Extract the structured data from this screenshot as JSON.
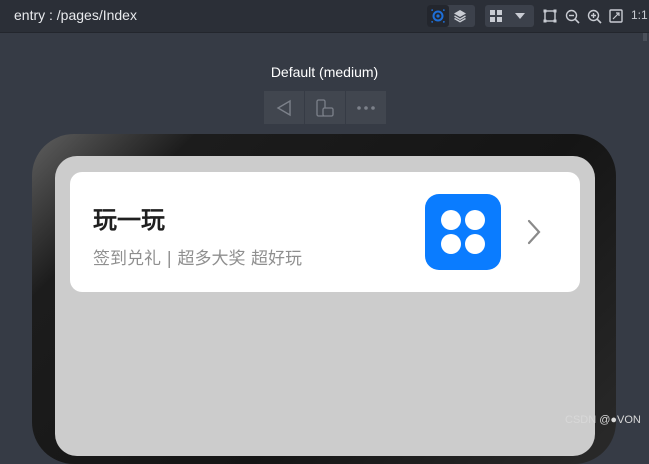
{
  "toolbar": {
    "route": "entry : /pages/Index",
    "zoom_one_to_one": "1:1",
    "icons": [
      "inspect-icon",
      "layers-icon",
      "layout-grid-icon",
      "dropdown-icon",
      "crop-icon",
      "zoom-out-icon",
      "zoom-in-icon",
      "fit-icon"
    ]
  },
  "preview": {
    "device_label": "Default (medium)",
    "controls": [
      "back-icon",
      "rotate-device-icon",
      "more-icon"
    ]
  },
  "card": {
    "title": "玩一玩",
    "subtitle": "签到兑礼 | 超多大奖 超好玩",
    "icon_color": "#0a7cff"
  },
  "watermark": "CSDN @●VON",
  "colors": {
    "background": "#363b45",
    "toolbar": "#2b2f37",
    "screen": "#cccccc",
    "card": "#ffffff",
    "accent": "#1e6fd9"
  }
}
